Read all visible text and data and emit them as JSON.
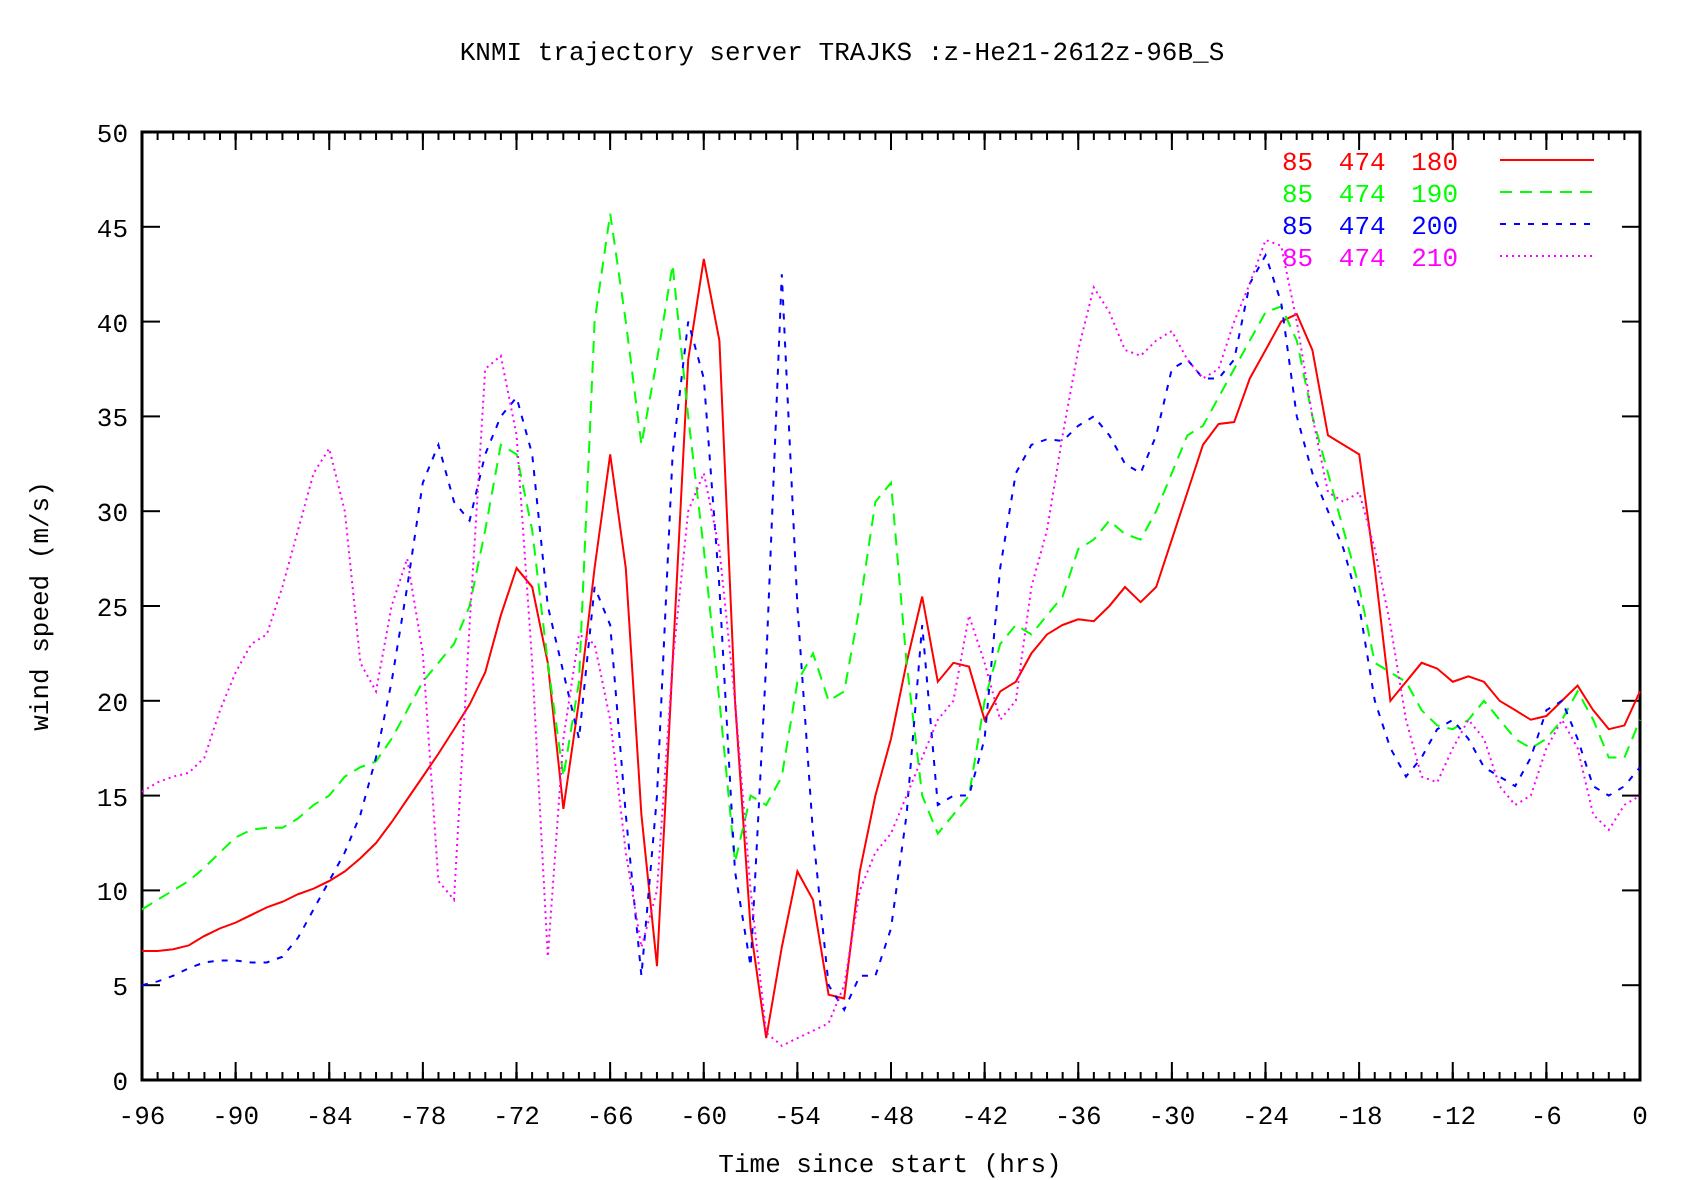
{
  "chart_data": {
    "type": "line",
    "title": "KNMI trajectory server TRAJKS :z-He21-2612z-96B_S",
    "xlabel": "Time since start (hrs)",
    "ylabel": "wind speed (m/s)",
    "x": [
      -96,
      -95,
      -94,
      -93,
      -92,
      -91,
      -90,
      -89,
      -88,
      -87,
      -86,
      -85,
      -84,
      -83,
      -82,
      -81,
      -80,
      -79,
      -78,
      -77,
      -76,
      -75,
      -74,
      -73,
      -72,
      -71,
      -70,
      -69,
      -68,
      -67,
      -66,
      -65,
      -64,
      -63,
      -62,
      -61,
      -60,
      -59,
      -58,
      -57,
      -56,
      -55,
      -54,
      -53,
      -52,
      -51,
      -50,
      -49,
      -48,
      -47,
      -46,
      -45,
      -44,
      -43,
      -42,
      -41,
      -40,
      -39,
      -38,
      -37,
      -36,
      -35,
      -34,
      -33,
      -32,
      -31,
      -30,
      -29,
      -28,
      -27,
      -26,
      -25,
      -24,
      -23,
      -22,
      -21,
      -20,
      -19,
      -18,
      -17,
      -16,
      -15,
      -14,
      -13,
      -12,
      -11,
      -10,
      -9,
      -8,
      -7,
      -6,
      -5,
      -4,
      -3,
      -2,
      -1,
      0
    ],
    "series": [
      {
        "name": "85 474 180",
        "color": "#ff0000",
        "line_style": "solid",
        "values": [
          6.8,
          6.8,
          6.9,
          7.1,
          7.6,
          8.0,
          8.3,
          8.7,
          9.1,
          9.4,
          9.8,
          10.1,
          10.5,
          11.0,
          11.7,
          12.5,
          13.6,
          14.8,
          16.0,
          17.2,
          18.5,
          19.8,
          21.5,
          24.5,
          27,
          26,
          22,
          14.3,
          20,
          27,
          33,
          27,
          14,
          6,
          22,
          38,
          43.3,
          39,
          20,
          8,
          2.2,
          7,
          11,
          9.5,
          4.5,
          4.3,
          11,
          15,
          18,
          22,
          25.5,
          21,
          22,
          21.8,
          19,
          20.5,
          21,
          22.5,
          23.5,
          24,
          24.3,
          24.2,
          25,
          26,
          25.2,
          26,
          28.5,
          31,
          33.5,
          34.6,
          34.7,
          37,
          38.5,
          40,
          40.4,
          38.5,
          34,
          33.5,
          33,
          27,
          20,
          21,
          22,
          21.7,
          21,
          21.3,
          21,
          20,
          19.5,
          19,
          19.2,
          20,
          20.8,
          19.5,
          18.5,
          18.7,
          20.5
        ]
      },
      {
        "name": "85 474 190",
        "color": "#00ff00",
        "line_style": "dashed",
        "values": [
          9,
          9.5,
          10,
          10.5,
          11.2,
          12,
          12.8,
          13.2,
          13.3,
          13.3,
          13.8,
          14.5,
          15,
          16,
          16.5,
          16.8,
          18,
          19.5,
          21,
          22,
          23,
          25,
          29,
          33.5,
          33,
          29,
          22,
          16,
          21,
          40,
          45.7,
          40,
          33.5,
          38,
          43,
          35,
          28,
          20,
          11.5,
          15,
          14.5,
          16,
          21,
          22.5,
          20,
          20.5,
          25,
          30.5,
          31.5,
          22,
          15,
          13,
          14,
          15,
          20,
          23,
          24,
          23.5,
          24.5,
          25.5,
          28,
          28.5,
          29.5,
          28.8,
          28.5,
          30,
          32,
          34,
          34.5,
          36,
          37.5,
          39,
          40.5,
          40.8,
          39,
          35,
          32,
          29,
          26,
          22,
          21.5,
          21,
          19.5,
          18.7,
          18.5,
          19,
          20,
          19,
          18,
          17.5,
          18,
          19,
          20.5,
          19,
          17,
          17,
          19
        ]
      },
      {
        "name": "85 474 200",
        "color": "#0000ff",
        "line_style": "short-dashed",
        "values": [
          5,
          5.2,
          5.5,
          5.9,
          6.2,
          6.3,
          6.3,
          6.2,
          6.2,
          6.5,
          7.5,
          9,
          10.5,
          12,
          14,
          17,
          21,
          26,
          31.5,
          33.5,
          30.5,
          29.5,
          33,
          35,
          36,
          33,
          25,
          21.5,
          18,
          26,
          24,
          14,
          5.5,
          15,
          33,
          40,
          37,
          26,
          11,
          6,
          22,
          42.5,
          25,
          13,
          5,
          3.7,
          5.5,
          5.5,
          8,
          14,
          24,
          14.5,
          15,
          15,
          18,
          27,
          32,
          33.5,
          33.8,
          33.7,
          34.5,
          35,
          34,
          32.5,
          32,
          34,
          37.5,
          38,
          37,
          37,
          38,
          42,
          43.5,
          41,
          35,
          32,
          30,
          28,
          25,
          20,
          17.5,
          16,
          17,
          18.5,
          19,
          18,
          16.5,
          16,
          15.5,
          17,
          19.5,
          20,
          18,
          15.5,
          15,
          15.5,
          16.5
        ]
      },
      {
        "name": "85 474 210",
        "color": "#ff00ff",
        "line_style": "dotted",
        "values": [
          15.2,
          15.7,
          16,
          16.2,
          17,
          19.5,
          21.5,
          23,
          23.5,
          26,
          29,
          32,
          33.3,
          30,
          22,
          20.5,
          25,
          27.5,
          22.5,
          10.5,
          9.5,
          24,
          37.5,
          38.2,
          34,
          22,
          6.5,
          18,
          23.5,
          23,
          19,
          12,
          7,
          10,
          22,
          30,
          32,
          28,
          20,
          10,
          2.5,
          1.8,
          2.2,
          2.6,
          3,
          5,
          10,
          12,
          13,
          15,
          17,
          19,
          20,
          24.5,
          22,
          19,
          20,
          26,
          29,
          34,
          38.5,
          41.8,
          40.5,
          38.5,
          38.2,
          39,
          39.5,
          38,
          37,
          37.5,
          40,
          42,
          44.3,
          44,
          40,
          35,
          31,
          30.5,
          31,
          28,
          24,
          19,
          16,
          15.7,
          17.5,
          19,
          18,
          15.5,
          14.5,
          15,
          17.5,
          19,
          17.5,
          14,
          13.2,
          14.5,
          15
        ]
      }
    ],
    "legend": "top-right",
    "xlim": [
      -96,
      0
    ],
    "ylim": [
      0,
      50
    ],
    "xticks": [
      -96,
      -90,
      -84,
      -78,
      -72,
      -66,
      -60,
      -54,
      -48,
      -42,
      -36,
      -30,
      -24,
      -18,
      -12,
      -6,
      0
    ],
    "yticks": [
      0,
      5,
      10,
      15,
      20,
      25,
      30,
      35,
      40,
      45,
      50
    ]
  }
}
